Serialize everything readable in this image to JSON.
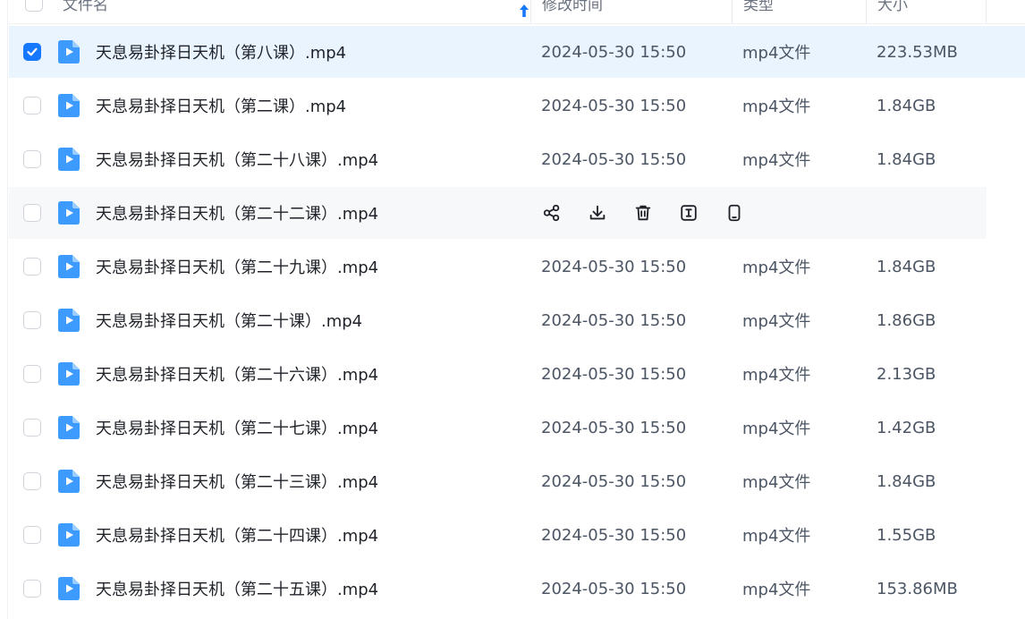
{
  "header": {
    "name": "文件名",
    "modified": "修改时间",
    "type": "类型",
    "size": "大小"
  },
  "colors": {
    "accent": "#1677ff",
    "file_icon": "#3d9bff",
    "selected_row": "#eaf4ff",
    "hover_row": "#f7f8fa"
  },
  "actions": [
    "share-icon",
    "download-icon",
    "trash-icon",
    "rename-icon",
    "mobile-icon"
  ],
  "files": [
    {
      "name": "天息易卦择日天机（第八课）.mp4",
      "time": "2024-05-30 15:50",
      "type": "mp4文件",
      "size": "223.53MB",
      "checked": true
    },
    {
      "name": "天息易卦择日天机（第二课）.mp4",
      "time": "2024-05-30 15:50",
      "type": "mp4文件",
      "size": "1.84GB",
      "checked": false
    },
    {
      "name": "天息易卦择日天机（第二十八课）.mp4",
      "time": "2024-05-30 15:50",
      "type": "mp4文件",
      "size": "1.84GB",
      "checked": false
    },
    {
      "name": "天息易卦择日天机（第二十二课）.mp4",
      "hover": true,
      "checked": false
    },
    {
      "name": "天息易卦择日天机（第二十九课）.mp4",
      "time": "2024-05-30 15:50",
      "type": "mp4文件",
      "size": "1.84GB",
      "checked": false
    },
    {
      "name": "天息易卦择日天机（第二十课）.mp4",
      "time": "2024-05-30 15:50",
      "type": "mp4文件",
      "size": "1.86GB",
      "checked": false
    },
    {
      "name": "天息易卦择日天机（第二十六课）.mp4",
      "time": "2024-05-30 15:50",
      "type": "mp4文件",
      "size": "2.13GB",
      "checked": false
    },
    {
      "name": "天息易卦择日天机（第二十七课）.mp4",
      "time": "2024-05-30 15:50",
      "type": "mp4文件",
      "size": "1.42GB",
      "checked": false
    },
    {
      "name": "天息易卦择日天机（第二十三课）.mp4",
      "time": "2024-05-30 15:50",
      "type": "mp4文件",
      "size": "1.84GB",
      "checked": false
    },
    {
      "name": "天息易卦择日天机（第二十四课）.mp4",
      "time": "2024-05-30 15:50",
      "type": "mp4文件",
      "size": "1.55GB",
      "checked": false
    },
    {
      "name": "天息易卦择日天机（第二十五课）.mp4",
      "time": "2024-05-30 15:50",
      "type": "mp4文件",
      "size": "153.86MB",
      "checked": false
    }
  ]
}
